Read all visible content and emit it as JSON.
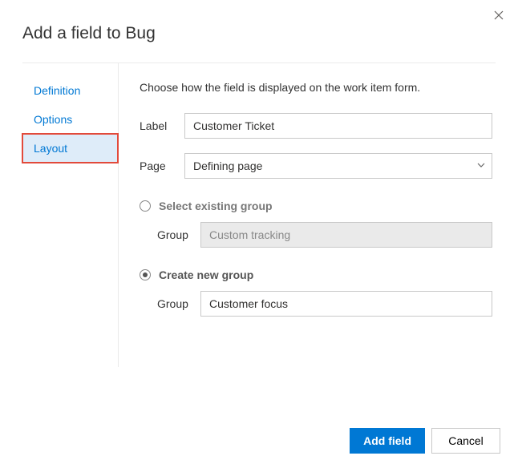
{
  "dialog": {
    "title": "Add a field to Bug"
  },
  "tabs": {
    "items": [
      {
        "label": "Definition",
        "active": false
      },
      {
        "label": "Options",
        "active": false
      },
      {
        "label": "Layout",
        "active": true
      }
    ]
  },
  "content": {
    "description": "Choose how the field is displayed on the work item form.",
    "label_field": {
      "label": "Label",
      "value": "Customer Ticket"
    },
    "page_field": {
      "label": "Page",
      "value": "Defining page"
    }
  },
  "groups": {
    "existing": {
      "radio_label": "Select existing group",
      "checked": false,
      "field_label": "Group",
      "value": "Custom tracking"
    },
    "create": {
      "radio_label": "Create new group",
      "checked": true,
      "field_label": "Group",
      "value": "Customer focus"
    }
  },
  "footer": {
    "primary": "Add field",
    "secondary": "Cancel"
  }
}
